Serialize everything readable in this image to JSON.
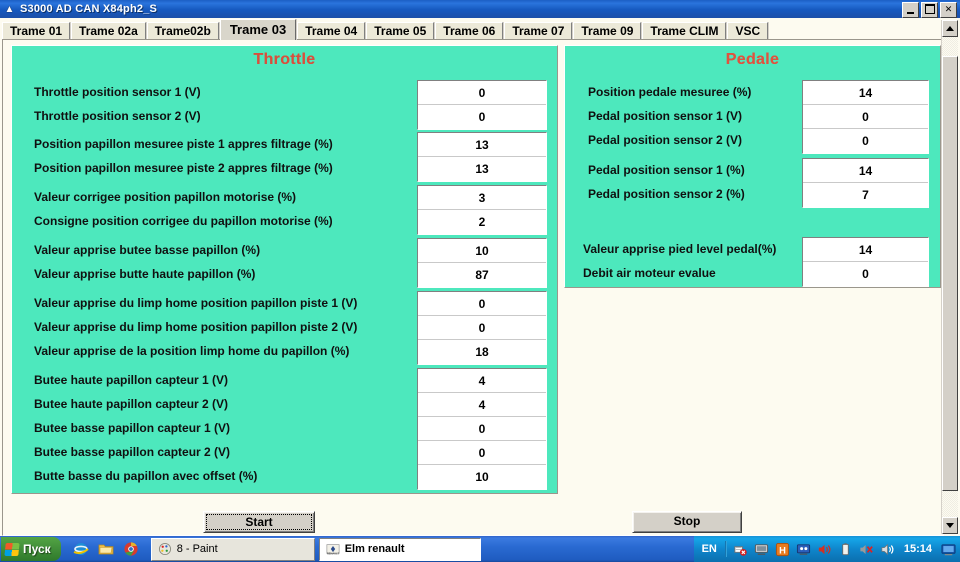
{
  "window": {
    "title": "S3000 AD CAN X84ph2_S",
    "icon": "app-icon",
    "minimize_label": "Minimize",
    "maximize_label": "Maximize",
    "close_label": "✕"
  },
  "tabs": [
    {
      "label": "Trame 01",
      "active": false
    },
    {
      "label": "Trame 02a",
      "active": false
    },
    {
      "label": "Trame02b",
      "active": false
    },
    {
      "label": "Trame 03",
      "active": true
    },
    {
      "label": "Trame 04",
      "active": false
    },
    {
      "label": "Trame 05",
      "active": false
    },
    {
      "label": "Trame 06",
      "active": false
    },
    {
      "label": "Trame 07",
      "active": false
    },
    {
      "label": "Trame 09",
      "active": false
    },
    {
      "label": "Trame CLIM",
      "active": false
    },
    {
      "label": "VSC",
      "active": false
    }
  ],
  "throttle": {
    "title": "Throttle",
    "groups": [
      {
        "rows": [
          {
            "label": "Throttle position sensor 1 (V)",
            "value": "0"
          },
          {
            "label": "Throttle position sensor 2 (V)",
            "value": "0"
          }
        ]
      },
      {
        "rows": [
          {
            "label": "Position papillon mesuree piste 1 appres filtrage (%)",
            "value": "13"
          },
          {
            "label": "Position papillon mesuree piste 2 appres filtrage (%)",
            "value": "13"
          }
        ]
      },
      {
        "rows": [
          {
            "label": "Valeur corrigee position papillon motorise (%)",
            "value": "3"
          },
          {
            "label": "Consigne position corrigee du papillon motorise (%)",
            "value": "2"
          }
        ]
      },
      {
        "rows": [
          {
            "label": "Valeur apprise butee basse papillon (%)",
            "value": "10"
          },
          {
            "label": "Valeur apprise butte haute papillon (%)",
            "value": "87"
          }
        ]
      },
      {
        "rows": [
          {
            "label": "Valeur apprise du limp home position papillon piste 1 (V)",
            "value": "0"
          },
          {
            "label": "Valeur apprise du limp home position papillon piste 2 (V)",
            "value": "0"
          },
          {
            "label": "Valeur apprise de la position limp home du papillon (%)",
            "value": "18"
          }
        ]
      },
      {
        "rows": [
          {
            "label": "Butee haute papillon capteur 1 (V)",
            "value": "4"
          },
          {
            "label": "Butee haute papillon capteur 2 (V)",
            "value": "4"
          },
          {
            "label": "Butee basse papillon capteur 1 (V)",
            "value": "0"
          },
          {
            "label": "Butee basse papillon capteur 2 (V)",
            "value": "0"
          },
          {
            "label": "Butte basse du papillon avec offset (%)",
            "value": "10"
          }
        ]
      }
    ]
  },
  "pedale": {
    "title": "Pedale",
    "groups": [
      {
        "rows": [
          {
            "label": "Position pedale mesuree (%)",
            "value": "14"
          },
          {
            "label": "Pedal position sensor 1 (V)",
            "value": "0"
          },
          {
            "label": "Pedal position sensor 2 (V)",
            "value": "0"
          }
        ]
      },
      {
        "rows": [
          {
            "label": "Pedal position sensor 1 (%)",
            "value": "14"
          },
          {
            "label": "Pedal position sensor 2 (%)",
            "value": "7"
          }
        ]
      },
      {
        "rows": [
          {
            "label": "Valeur apprise pied level pedal(%)",
            "value": "14"
          },
          {
            "label": "Debit air moteur evalue",
            "value": "0"
          }
        ]
      }
    ]
  },
  "buttons": {
    "start": "Start",
    "stop": "Stop"
  },
  "scrollbar": {
    "up_arrow": "scroll-up-arrow",
    "down_arrow": "scroll-down-arrow"
  },
  "taskbar": {
    "start_label": "Пуск",
    "quick_launch": [
      "internet-explorer-icon",
      "folder-icon",
      "chrome-icon"
    ],
    "tasks": [
      {
        "label": "8 - Paint",
        "icon": "paint-icon",
        "active": false
      },
      {
        "label": "Elm renault",
        "icon": "elm-icon",
        "active": true
      }
    ],
    "tray": {
      "language": "EN",
      "icons": [
        "network-disconnected-icon",
        "monitor-icon",
        "antivirus-icon",
        "remote-desktop-icon",
        "volume-icon",
        "battery-icon",
        "sound-muted-icon",
        "speaker-icon"
      ],
      "clock": "15:14",
      "show_desktop": "show-desktop-icon"
    }
  },
  "colors": {
    "panel_bg": "#4de8bd",
    "panel_title": "#d94f3d",
    "client_bg": "#fdfbf0",
    "titlebar": "#1b5cc0",
    "taskbar": "#2a6ad2"
  }
}
